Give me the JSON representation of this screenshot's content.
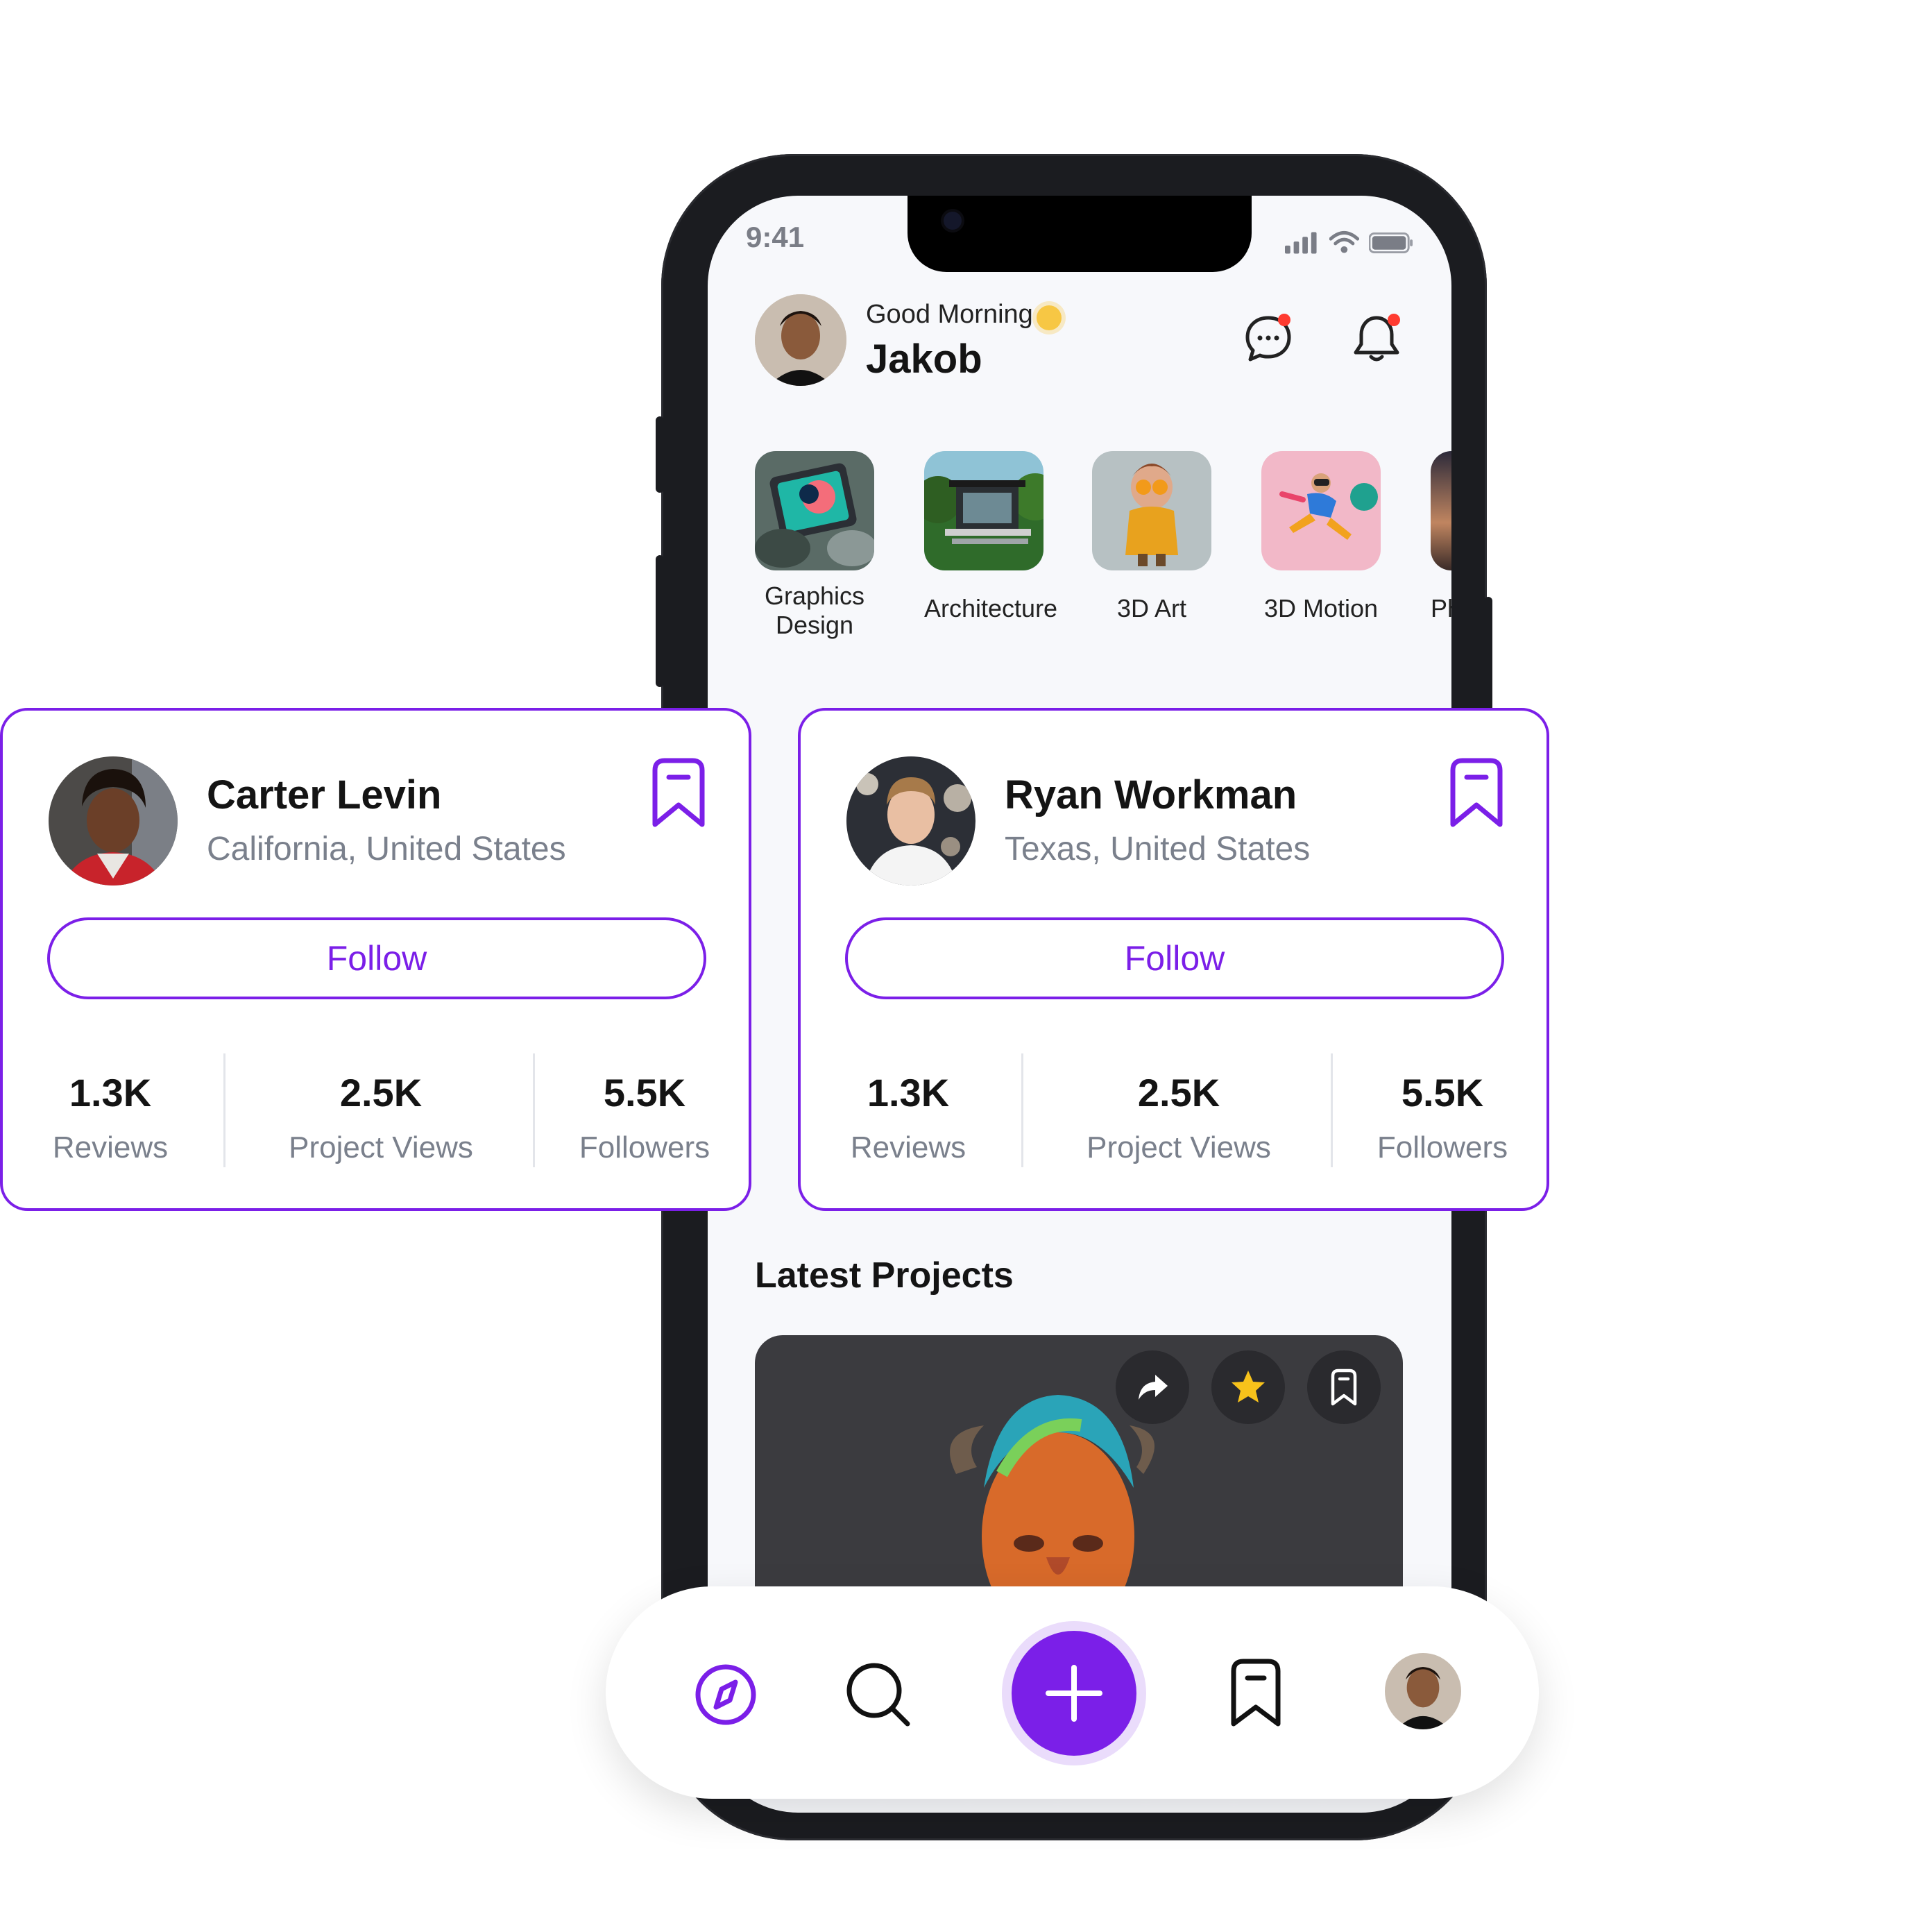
{
  "status_bar": {
    "time": "9:41"
  },
  "header": {
    "greeting": "Good Morning",
    "user_name": "Jakob",
    "message_icon": "chat-bubble-icon",
    "notification_icon": "bell-icon"
  },
  "categories": [
    {
      "label": "Graphics Design"
    },
    {
      "label": "Architecture"
    },
    {
      "label": "3D Art"
    },
    {
      "label": "3D Motion"
    },
    {
      "label": "Pho"
    }
  ],
  "profiles": [
    {
      "name": "Carter Levin",
      "location": "California, United States",
      "follow_label": "Follow",
      "stats": [
        {
          "value": "1.3K",
          "label": "Reviews"
        },
        {
          "value": "2.5K",
          "label": "Project Views"
        },
        {
          "value": "5.5K",
          "label": "Followers"
        }
      ]
    },
    {
      "name": "Ryan Workman",
      "location": "Texas, United States",
      "follow_label": "Follow",
      "stats": [
        {
          "value": "1.3K",
          "label": "Reviews"
        },
        {
          "value": "2.5K",
          "label": "Project Views"
        },
        {
          "value": "5.5K",
          "label": "Followers"
        }
      ]
    }
  ],
  "latest_projects": {
    "title": "Latest Projects"
  },
  "bottom_nav": {
    "items": [
      "compass-icon",
      "search-icon",
      "plus-icon",
      "bookmark-icon",
      "avatar"
    ]
  },
  "colors": {
    "accent": "#7b1fe8",
    "badge": "#ff3b30",
    "star": "#f7c21b"
  }
}
